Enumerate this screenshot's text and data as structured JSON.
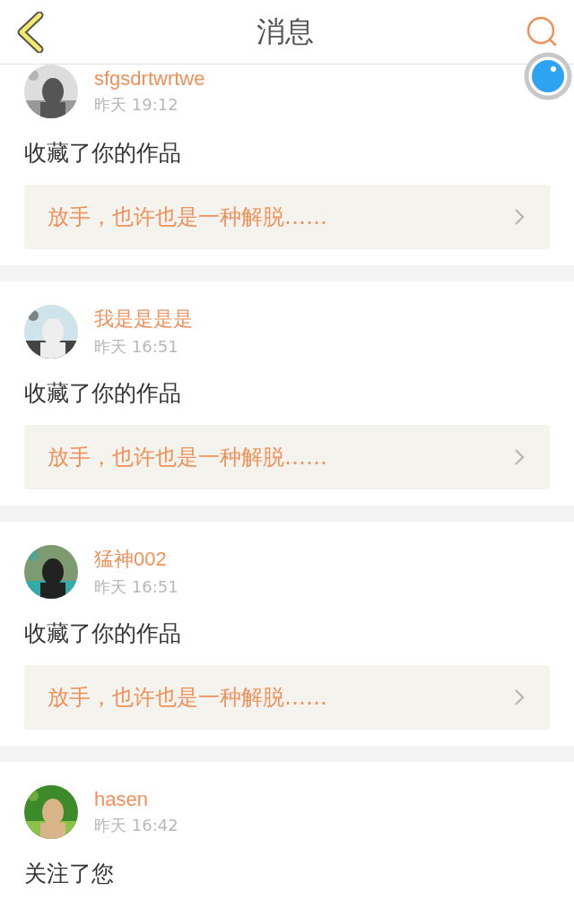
{
  "header": {
    "title": "消息"
  },
  "messages": [
    {
      "user": "sfgsdrtwrtwe",
      "time": "昨天 19:12",
      "action": "收藏了你的作品",
      "quote": "放手，也许也是一种解脱……"
    },
    {
      "user": "我是是是是",
      "time": "昨天 16:51",
      "action": "收藏了你的作品",
      "quote": "放手，也许也是一种解脱……"
    },
    {
      "user": "猛神002",
      "time": "昨天 16:51",
      "action": "收藏了你的作品",
      "quote": "放手，也许也是一种解脱……"
    },
    {
      "user": "hasen",
      "time": "昨天 16:42",
      "action": "关注了您"
    }
  ]
}
